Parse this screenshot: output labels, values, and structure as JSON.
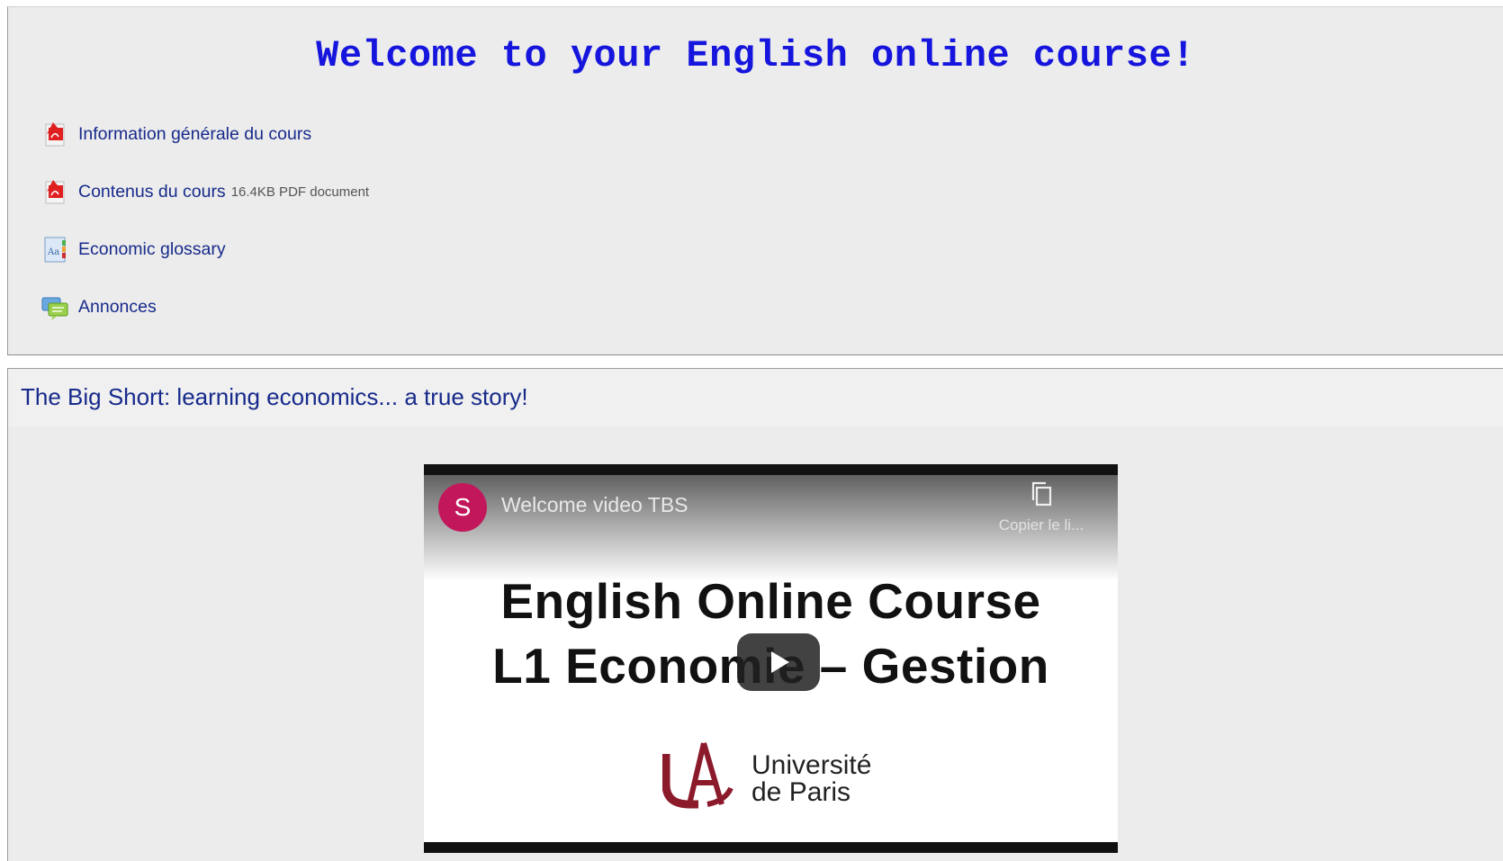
{
  "intro": {
    "title": "Welcome to your English online course!",
    "activities": [
      {
        "label": "Information générale du cours",
        "icon": "pdf-icon"
      },
      {
        "label": "Contenus du cours",
        "meta": "16.4KB PDF document",
        "icon": "pdf-icon"
      },
      {
        "label": "Economic glossary",
        "icon": "glossary-icon"
      },
      {
        "label": "Annonces",
        "icon": "forum-icon"
      }
    ]
  },
  "video_section": {
    "title": "The Big Short: learning economics... a true story!",
    "player": {
      "channel_initial": "S",
      "video_title": "Welcome video TBS",
      "copy_link_label": "Copier le li...",
      "slide_line_1": "English Online Course",
      "slide_line_2": "L1 Economie – Gestion",
      "university_line_1": "Université",
      "university_line_2": "de Paris"
    }
  },
  "colors": {
    "title_blue": "#1515dd",
    "link_blue": "#172a8b",
    "section_bg": "#ececec",
    "avatar": "#c2185b",
    "university_red": "#8b1a2b"
  }
}
